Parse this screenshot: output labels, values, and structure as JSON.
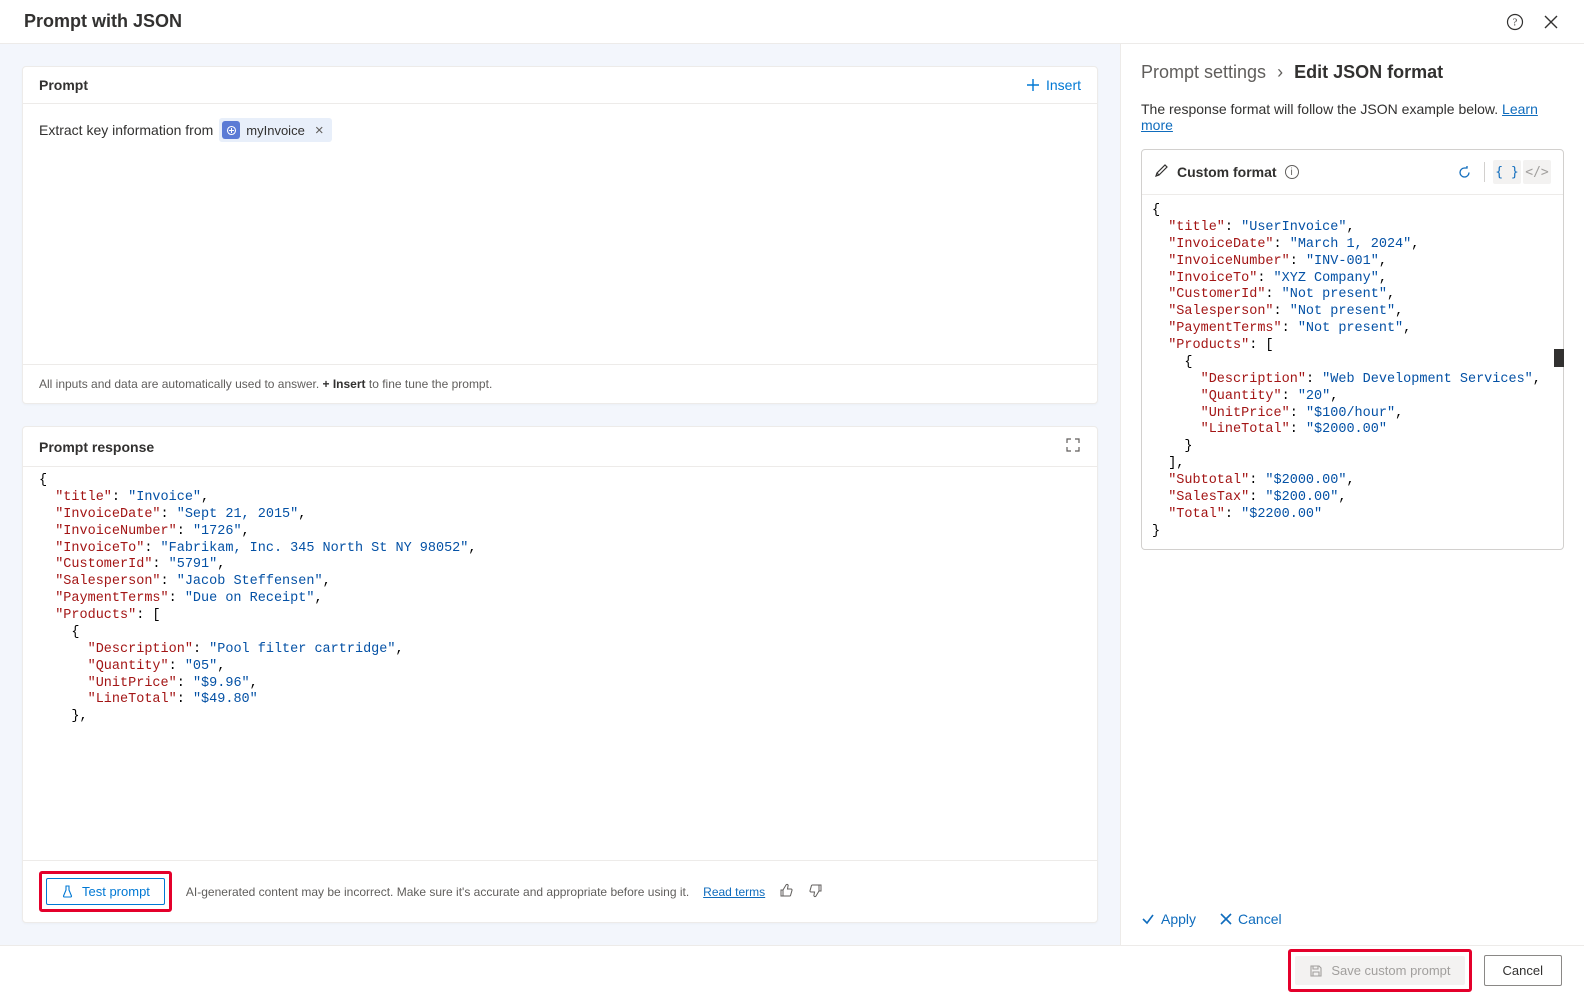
{
  "header": {
    "title": "Prompt with JSON"
  },
  "prompt_card": {
    "title": "Prompt",
    "insert_label": "Insert",
    "text_prefix": "Extract key information from",
    "chip_label": "myInvoice",
    "footer_prefix": "All inputs and data are automatically used to answer. ",
    "footer_bold": "+ Insert",
    "footer_suffix": " to fine tune the prompt."
  },
  "response_card": {
    "title": "Prompt response",
    "json_lines": [
      [
        [
          "j-punc",
          "{"
        ]
      ],
      [
        [
          "j-punc",
          "  "
        ],
        [
          "j-key",
          "\"title\""
        ],
        [
          "j-punc",
          ": "
        ],
        [
          "j-str",
          "\"Invoice\""
        ],
        [
          "j-punc",
          ","
        ]
      ],
      [
        [
          "j-punc",
          "  "
        ],
        [
          "j-key",
          "\"InvoiceDate\""
        ],
        [
          "j-punc",
          ": "
        ],
        [
          "j-str",
          "\"Sept 21, 2015\""
        ],
        [
          "j-punc",
          ","
        ]
      ],
      [
        [
          "j-punc",
          "  "
        ],
        [
          "j-key",
          "\"InvoiceNumber\""
        ],
        [
          "j-punc",
          ": "
        ],
        [
          "j-str",
          "\"1726\""
        ],
        [
          "j-punc",
          ","
        ]
      ],
      [
        [
          "j-punc",
          "  "
        ],
        [
          "j-key",
          "\"InvoiceTo\""
        ],
        [
          "j-punc",
          ": "
        ],
        [
          "j-str",
          "\"Fabrikam, Inc. 345 North St NY 98052\""
        ],
        [
          "j-punc",
          ","
        ]
      ],
      [
        [
          "j-punc",
          "  "
        ],
        [
          "j-key",
          "\"CustomerId\""
        ],
        [
          "j-punc",
          ": "
        ],
        [
          "j-str",
          "\"5791\""
        ],
        [
          "j-punc",
          ","
        ]
      ],
      [
        [
          "j-punc",
          "  "
        ],
        [
          "j-key",
          "\"Salesperson\""
        ],
        [
          "j-punc",
          ": "
        ],
        [
          "j-str",
          "\"Jacob Steffensen\""
        ],
        [
          "j-punc",
          ","
        ]
      ],
      [
        [
          "j-punc",
          "  "
        ],
        [
          "j-key",
          "\"PaymentTerms\""
        ],
        [
          "j-punc",
          ": "
        ],
        [
          "j-str",
          "\"Due on Receipt\""
        ],
        [
          "j-punc",
          ","
        ]
      ],
      [
        [
          "j-punc",
          "  "
        ],
        [
          "j-key",
          "\"Products\""
        ],
        [
          "j-punc",
          ": ["
        ]
      ],
      [
        [
          "j-punc",
          "    {"
        ]
      ],
      [
        [
          "j-punc",
          "      "
        ],
        [
          "j-key",
          "\"Description\""
        ],
        [
          "j-punc",
          ": "
        ],
        [
          "j-str",
          "\"Pool filter cartridge\""
        ],
        [
          "j-punc",
          ","
        ]
      ],
      [
        [
          "j-punc",
          "      "
        ],
        [
          "j-key",
          "\"Quantity\""
        ],
        [
          "j-punc",
          ": "
        ],
        [
          "j-str",
          "\"05\""
        ],
        [
          "j-punc",
          ","
        ]
      ],
      [
        [
          "j-punc",
          "      "
        ],
        [
          "j-key",
          "\"UnitPrice\""
        ],
        [
          "j-punc",
          ": "
        ],
        [
          "j-str",
          "\"$9.96\""
        ],
        [
          "j-punc",
          ","
        ]
      ],
      [
        [
          "j-punc",
          "      "
        ],
        [
          "j-key",
          "\"LineTotal\""
        ],
        [
          "j-punc",
          ": "
        ],
        [
          "j-str",
          "\"$49.80\""
        ]
      ],
      [
        [
          "j-punc",
          "    },"
        ]
      ]
    ],
    "test_label": "Test prompt",
    "disclaimer": "AI-generated content may be incorrect. Make sure it's accurate and appropriate before using it.",
    "read_terms": "Read terms"
  },
  "right_panel": {
    "breadcrumb1": "Prompt settings",
    "breadcrumb2": "Edit JSON format",
    "hint_text": "The response format will follow the JSON example below. ",
    "learn_more": "Learn more",
    "format_title": "Custom format",
    "json_lines": [
      [
        [
          "j-punc",
          "{"
        ]
      ],
      [
        [
          "j-punc",
          "  "
        ],
        [
          "j-key",
          "\"title\""
        ],
        [
          "j-punc",
          ": "
        ],
        [
          "j-str",
          "\"UserInvoice\""
        ],
        [
          "j-punc",
          ","
        ]
      ],
      [
        [
          "j-punc",
          "  "
        ],
        [
          "j-key",
          "\"InvoiceDate\""
        ],
        [
          "j-punc",
          ": "
        ],
        [
          "j-str",
          "\"March 1, 2024\""
        ],
        [
          "j-punc",
          ","
        ]
      ],
      [
        [
          "j-punc",
          "  "
        ],
        [
          "j-key",
          "\"InvoiceNumber\""
        ],
        [
          "j-punc",
          ": "
        ],
        [
          "j-str",
          "\"INV-001\""
        ],
        [
          "j-punc",
          ","
        ]
      ],
      [
        [
          "j-punc",
          "  "
        ],
        [
          "j-key",
          "\"InvoiceTo\""
        ],
        [
          "j-punc",
          ": "
        ],
        [
          "j-str",
          "\"XYZ Company\""
        ],
        [
          "j-punc",
          ","
        ]
      ],
      [
        [
          "j-punc",
          "  "
        ],
        [
          "j-key",
          "\"CustomerId\""
        ],
        [
          "j-punc",
          ": "
        ],
        [
          "j-str",
          "\"Not present\""
        ],
        [
          "j-punc",
          ","
        ]
      ],
      [
        [
          "j-punc",
          "  "
        ],
        [
          "j-key",
          "\"Salesperson\""
        ],
        [
          "j-punc",
          ": "
        ],
        [
          "j-str",
          "\"Not present\""
        ],
        [
          "j-punc",
          ","
        ]
      ],
      [
        [
          "j-punc",
          "  "
        ],
        [
          "j-key",
          "\"PaymentTerms\""
        ],
        [
          "j-punc",
          ": "
        ],
        [
          "j-str",
          "\"Not present\""
        ],
        [
          "j-punc",
          ","
        ]
      ],
      [
        [
          "j-punc",
          "  "
        ],
        [
          "j-key",
          "\"Products\""
        ],
        [
          "j-punc",
          ": ["
        ]
      ],
      [
        [
          "j-punc",
          "    {"
        ]
      ],
      [
        [
          "j-punc",
          "      "
        ],
        [
          "j-key",
          "\"Description\""
        ],
        [
          "j-punc",
          ": "
        ],
        [
          "j-str",
          "\"Web Development Services\""
        ],
        [
          "j-punc",
          ","
        ]
      ],
      [
        [
          "j-punc",
          "      "
        ],
        [
          "j-key",
          "\"Quantity\""
        ],
        [
          "j-punc",
          ": "
        ],
        [
          "j-str",
          "\"20\""
        ],
        [
          "j-punc",
          ","
        ]
      ],
      [
        [
          "j-punc",
          "      "
        ],
        [
          "j-key",
          "\"UnitPrice\""
        ],
        [
          "j-punc",
          ": "
        ],
        [
          "j-str",
          "\"$100/hour\""
        ],
        [
          "j-punc",
          ","
        ]
      ],
      [
        [
          "j-punc",
          "      "
        ],
        [
          "j-key",
          "\"LineTotal\""
        ],
        [
          "j-punc",
          ": "
        ],
        [
          "j-str",
          "\"$2000.00\""
        ]
      ],
      [
        [
          "j-punc",
          "    }"
        ]
      ],
      [
        [
          "j-punc",
          "  ],"
        ]
      ],
      [
        [
          "j-punc",
          "  "
        ],
        [
          "j-key",
          "\"Subtotal\""
        ],
        [
          "j-punc",
          ": "
        ],
        [
          "j-str",
          "\"$2000.00\""
        ],
        [
          "j-punc",
          ","
        ]
      ],
      [
        [
          "j-punc",
          "  "
        ],
        [
          "j-key",
          "\"SalesTax\""
        ],
        [
          "j-punc",
          ": "
        ],
        [
          "j-str",
          "\"$200.00\""
        ],
        [
          "j-punc",
          ","
        ]
      ],
      [
        [
          "j-punc",
          "  "
        ],
        [
          "j-key",
          "\"Total\""
        ],
        [
          "j-punc",
          ": "
        ],
        [
          "j-str",
          "\"$2200.00\""
        ]
      ],
      [
        [
          "j-punc",
          "}"
        ]
      ]
    ],
    "apply_label": "Apply",
    "cancel_label": "Cancel"
  },
  "footer": {
    "save_label": "Save custom prompt",
    "cancel_label": "Cancel"
  }
}
